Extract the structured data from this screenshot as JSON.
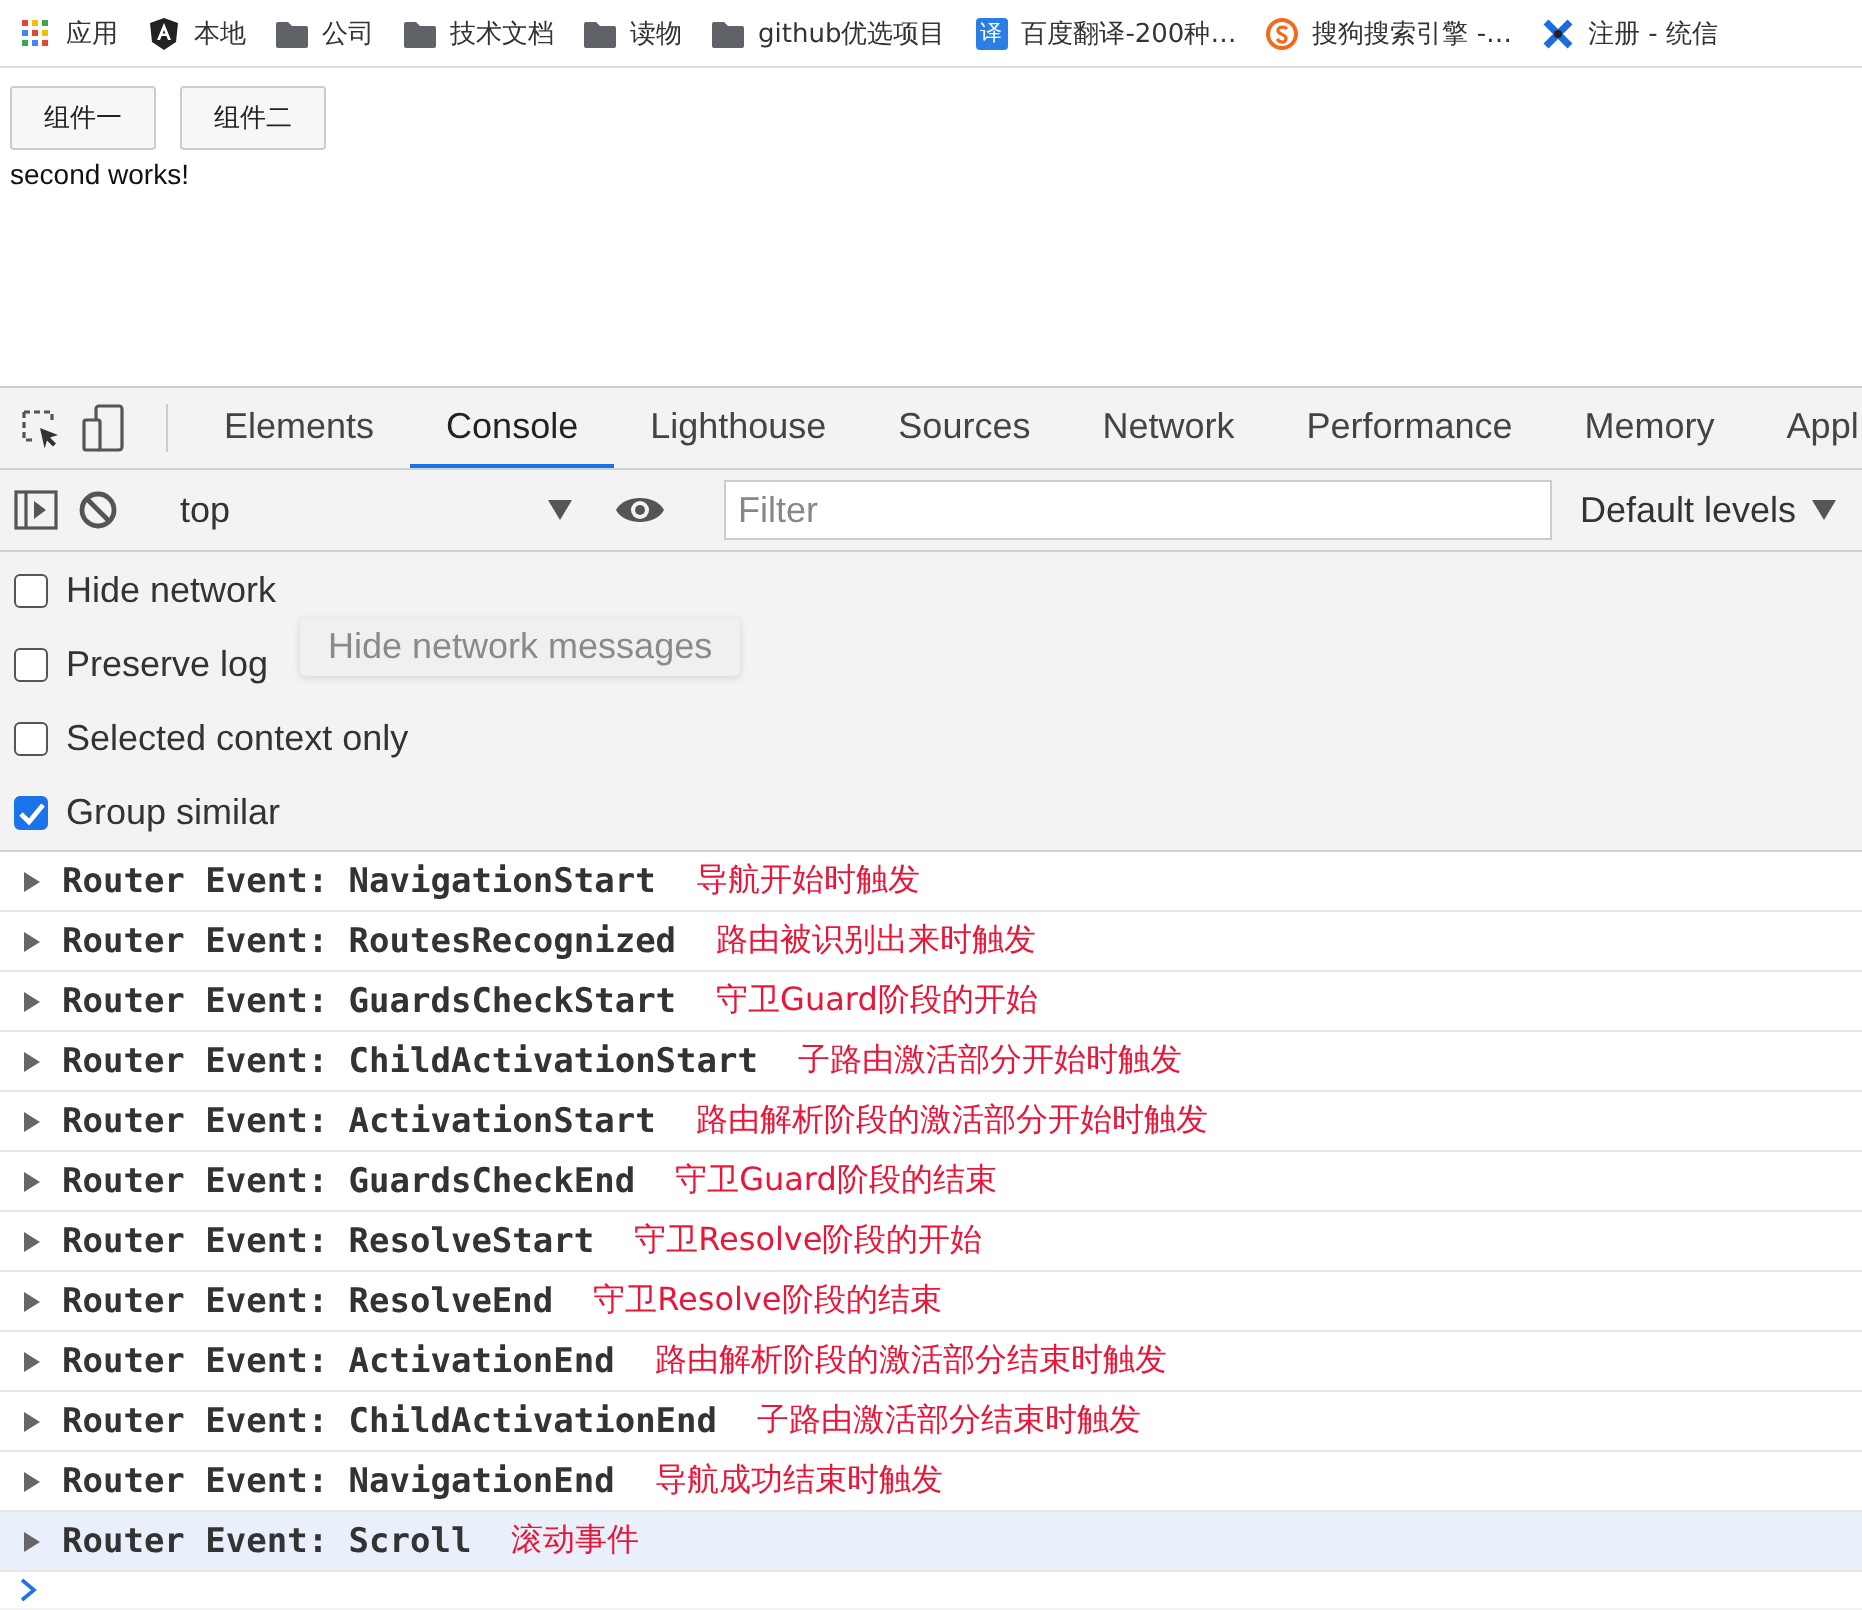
{
  "bookmarks": [
    {
      "kind": "apps",
      "label": "应用"
    },
    {
      "kind": "angular",
      "label": "本地"
    },
    {
      "kind": "folder",
      "label": "公司"
    },
    {
      "kind": "folder",
      "label": "技术文档"
    },
    {
      "kind": "folder",
      "label": "读物"
    },
    {
      "kind": "folder",
      "label": "github优选项目"
    },
    {
      "kind": "translate",
      "label": "百度翻译-200种…",
      "icon_text": "译"
    },
    {
      "kind": "sogou",
      "label": "搜狗搜索引擎 -…"
    },
    {
      "kind": "cross",
      "label": "注册 - 统信"
    }
  ],
  "page": {
    "buttons": [
      "组件一",
      "组件二"
    ],
    "output": "second works!"
  },
  "devtools": {
    "tabs": [
      {
        "label": "Elements",
        "selected": false
      },
      {
        "label": "Console",
        "selected": true
      },
      {
        "label": "Lighthouse",
        "selected": false
      },
      {
        "label": "Sources",
        "selected": false
      },
      {
        "label": "Network",
        "selected": false
      },
      {
        "label": "Performance",
        "selected": false
      },
      {
        "label": "Memory",
        "selected": false
      },
      {
        "label": "Appl",
        "selected": false
      }
    ],
    "context": "top",
    "filter": {
      "placeholder": "Filter"
    },
    "levels": "Default levels",
    "settings": [
      {
        "label": "Hide network",
        "checked": false
      },
      {
        "label": "Preserve log",
        "checked": false
      },
      {
        "label": "Selected context only",
        "checked": false
      },
      {
        "label": "Group similar",
        "checked": true
      }
    ],
    "tooltip": "Hide network messages",
    "logs": [
      {
        "message": "Router Event: NavigationStart",
        "note": "导航开始时触发",
        "selected": false
      },
      {
        "message": "Router Event: RoutesRecognized",
        "note": "路由被识别出来时触发",
        "selected": false
      },
      {
        "message": "Router Event: GuardsCheckStart",
        "note": "守卫Guard阶段的开始",
        "selected": false
      },
      {
        "message": "Router Event: ChildActivationStart",
        "note": "子路由激活部分开始时触发",
        "selected": false
      },
      {
        "message": "Router Event: ActivationStart",
        "note": "路由解析阶段的激活部分开始时触发",
        "selected": false
      },
      {
        "message": "Router Event: GuardsCheckEnd",
        "note": "守卫Guard阶段的结束",
        "selected": false
      },
      {
        "message": "Router Event: ResolveStart",
        "note": "守卫Resolve阶段的开始",
        "selected": false
      },
      {
        "message": "Router Event: ResolveEnd",
        "note": "守卫Resolve阶段的结束",
        "selected": false
      },
      {
        "message": "Router Event: ActivationEnd",
        "note": "路由解析阶段的激活部分结束时触发",
        "selected": false
      },
      {
        "message": "Router Event: ChildActivationEnd",
        "note": "子路由激活部分结束时触发",
        "selected": false
      },
      {
        "message": "Router Event: NavigationEnd",
        "note": "导航成功结束时触发",
        "selected": false
      },
      {
        "message": "Router Event: Scroll",
        "note": "滚动事件",
        "selected": true
      }
    ]
  }
}
